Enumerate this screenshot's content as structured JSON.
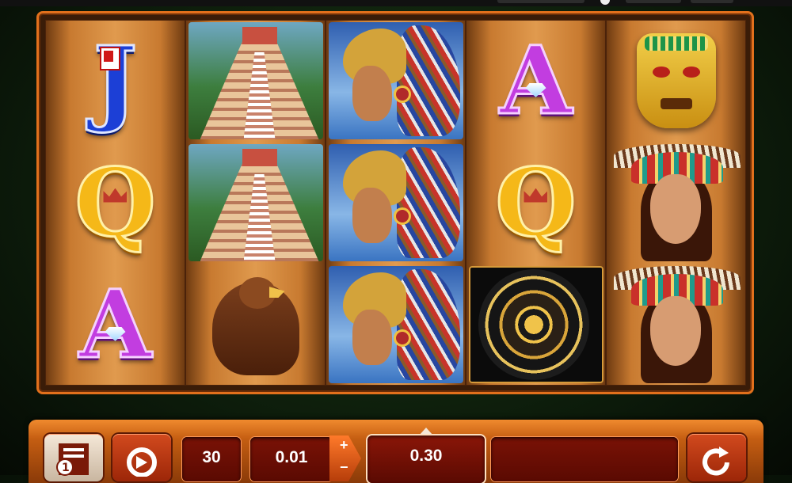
{
  "reels": [
    [
      "J",
      "Q",
      "A"
    ],
    [
      "pyramid",
      "pyramid",
      "eagle"
    ],
    [
      "warrior",
      "warrior",
      "warrior"
    ],
    [
      "A",
      "Q",
      "calendar"
    ],
    [
      "mask",
      "princess",
      "princess"
    ]
  ],
  "controls": {
    "paytable_icon": "paytable-icon",
    "autoplay_icon": "autoplay-icon",
    "lines_value": "30",
    "line_bet_value": "0.01",
    "plus_label": "+",
    "minus_label": "−",
    "total_bet_value": "0.30",
    "win_value": "",
    "spin_icon": "spin-icon"
  },
  "colors": {
    "frame": "#e2701c",
    "panel": "#c55e12"
  }
}
